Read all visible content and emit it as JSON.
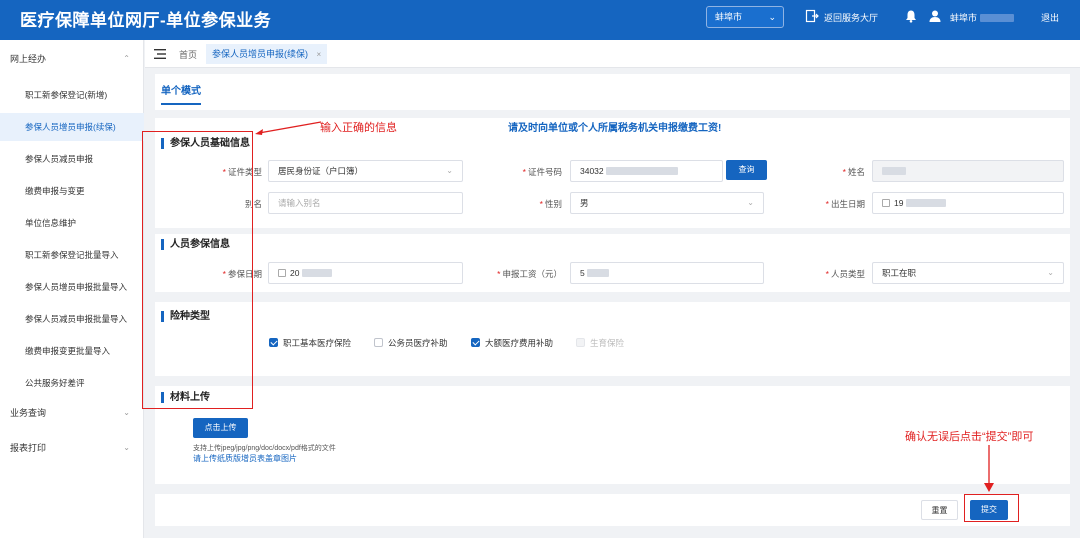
{
  "header": {
    "title": "医疗保障单位网厅-单位参保业务",
    "city": "蚌埠市",
    "back_hall": "返回服务大厅",
    "user_city": "蚌埠市",
    "logout": "退出"
  },
  "sidebar": {
    "group_online": "网上经办",
    "items": [
      {
        "label": "职工新参保登记(新增)"
      },
      {
        "label": "参保人员增员申报(续保)"
      },
      {
        "label": "参保人员减员申报"
      },
      {
        "label": "缴费申报与变更"
      },
      {
        "label": "单位信息维护"
      },
      {
        "label": "职工新参保登记批量导入"
      },
      {
        "label": "参保人员增员申报批量导入"
      },
      {
        "label": "参保人员减员申报批量导入"
      },
      {
        "label": "缴费申报变更批量导入"
      },
      {
        "label": "公共服务好差评"
      }
    ],
    "group_query": "业务查询",
    "group_print": "报表打印"
  },
  "tabs": {
    "home": "首页",
    "active": "参保人员增员申报(续保)",
    "close": "×"
  },
  "form": {
    "mode_tab": "单个模式",
    "notice": "请及时向单位或个人所属税务机关申报缴费工资!",
    "basic": {
      "title": "参保人员基础信息",
      "id_type_label": "证件类型",
      "id_type_value": "居民身份证（户口簿）",
      "id_no_label": "证件号码",
      "id_no_value": "34032",
      "query_button": "查询",
      "name_label": "姓名",
      "alias_label": "别名",
      "alias_placeholder": "请输入别名",
      "gender_label": "性别",
      "gender_value": "男",
      "birth_label": "出生日期",
      "birth_value": "19"
    },
    "insured": {
      "title": "人员参保信息",
      "date_label": "参保日期",
      "date_value": "20",
      "wage_label": "申报工资（元）",
      "wage_value": "5",
      "type_label": "人员类型",
      "type_value": "职工在职"
    },
    "insurance": {
      "title": "险种类型",
      "options": [
        {
          "label": "职工基本医疗保险",
          "checked": true
        },
        {
          "label": "公务员医疗补助",
          "checked": false
        },
        {
          "label": "大额医疗费用补助",
          "checked": true
        },
        {
          "label": "生育保险",
          "checked": false
        }
      ]
    },
    "upload": {
      "title": "材料上传",
      "button": "点击上传",
      "hint": "支持上传jpeg/jpg/png/doc/docx/pdf格式的文件",
      "link": "请上传纸质版增员表盖章图片"
    },
    "footer": {
      "reset": "重置",
      "submit": "提交"
    }
  },
  "annotations": {
    "enter_info": "输入正确的信息",
    "confirm_submit": "确认无误后点击“提交”即可"
  },
  "colors": {
    "primary": "#1565c0",
    "annotation": "#e02020"
  }
}
